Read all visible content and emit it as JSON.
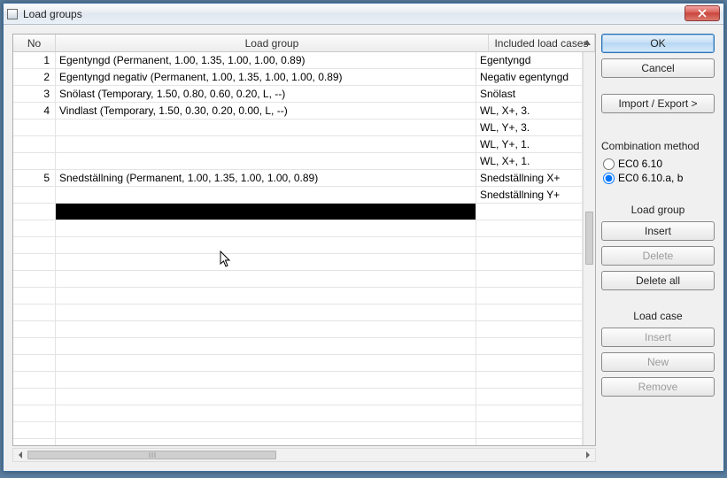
{
  "window": {
    "title": "Load groups"
  },
  "columns": {
    "no": "No",
    "group": "Load group",
    "cases": "Included load cases"
  },
  "rows": [
    {
      "no": "1",
      "group": "Egentyngd  (Permanent, 1.00, 1.35, 1.00, 1.00, 0.89)",
      "case": "Egentyngd"
    },
    {
      "no": "2",
      "group": "Egentyngd negativ  (Permanent, 1.00, 1.35, 1.00, 1.00, 0.89)",
      "case": "Negativ egentyngd"
    },
    {
      "no": "3",
      "group": "Snölast  (Temporary, 1.50, 0.80, 0.60, 0.20, L, --)",
      "case": "Snölast"
    },
    {
      "no": "4",
      "group": "Vindlast  (Temporary, 1.50, 0.30, 0.20, 0.00, L, --)",
      "case": "WL, X+, 3."
    },
    {
      "no": "",
      "group": "",
      "case": "WL, Y+, 3."
    },
    {
      "no": "",
      "group": "",
      "case": "WL, Y+, 1."
    },
    {
      "no": "",
      "group": "",
      "case": "WL, X+, 1."
    },
    {
      "no": "5",
      "group": "Snedställning  (Permanent, 1.00, 1.35, 1.00, 1.00, 0.89)",
      "case": "Snedställning X+"
    },
    {
      "no": "",
      "group": "",
      "case": "Snedställning Y+"
    }
  ],
  "side": {
    "ok": "OK",
    "cancel": "Cancel",
    "import_export": "Import / Export >",
    "combination_method": "Combination method",
    "radio1": "EC0 6.10",
    "radio2": "EC0 6.10.a, b",
    "load_group": "Load group",
    "lg_insert": "Insert",
    "lg_delete": "Delete",
    "lg_delete_all": "Delete all",
    "load_case": "Load case",
    "lc_insert": "Insert",
    "lc_new": "New",
    "lc_remove": "Remove"
  }
}
